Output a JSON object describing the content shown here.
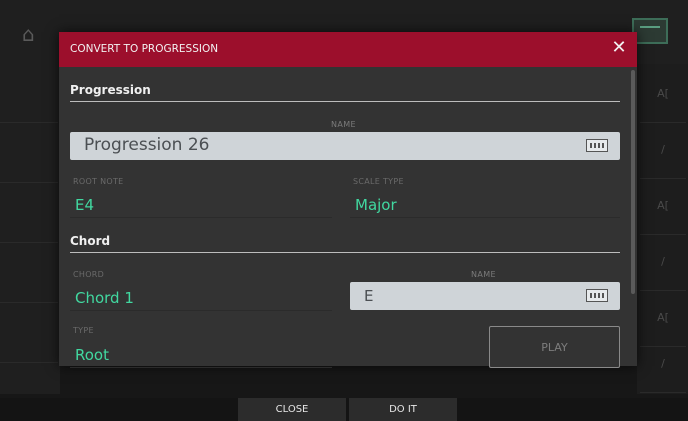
{
  "dialog": {
    "title": "CONVERT TO PROGRESSION",
    "close_glyph": "✕",
    "progression": {
      "section_title": "Progression",
      "name_label": "NAME",
      "name_value": "Progression 26",
      "root_note_label": "ROOT NOTE",
      "root_note_value": "E4",
      "scale_type_label": "SCALE TYPE",
      "scale_type_value": "Major"
    },
    "chord": {
      "section_title": "Chord",
      "chord_label": "CHORD",
      "chord_value": "Chord 1",
      "name_label": "NAME",
      "name_value": "E",
      "type_label": "TYPE",
      "type_value": "Root",
      "play_label": "PLAY"
    }
  },
  "bottom_bar": {
    "close_label": "CLOSE",
    "doit_label": "DO IT"
  },
  "background": {
    "right_labels": [
      "A[",
      "/",
      "A[",
      "/",
      "A[",
      "/"
    ]
  },
  "colors": {
    "header": "#9c0f2c",
    "accent_value": "#41d8a0",
    "dialog_bg": "#333333",
    "input_bg": "#cfd4d8"
  },
  "icons": {
    "close": "close-icon",
    "keyboard": "keyboard-icon",
    "home": "home-icon",
    "monitor": "monitor-icon"
  }
}
